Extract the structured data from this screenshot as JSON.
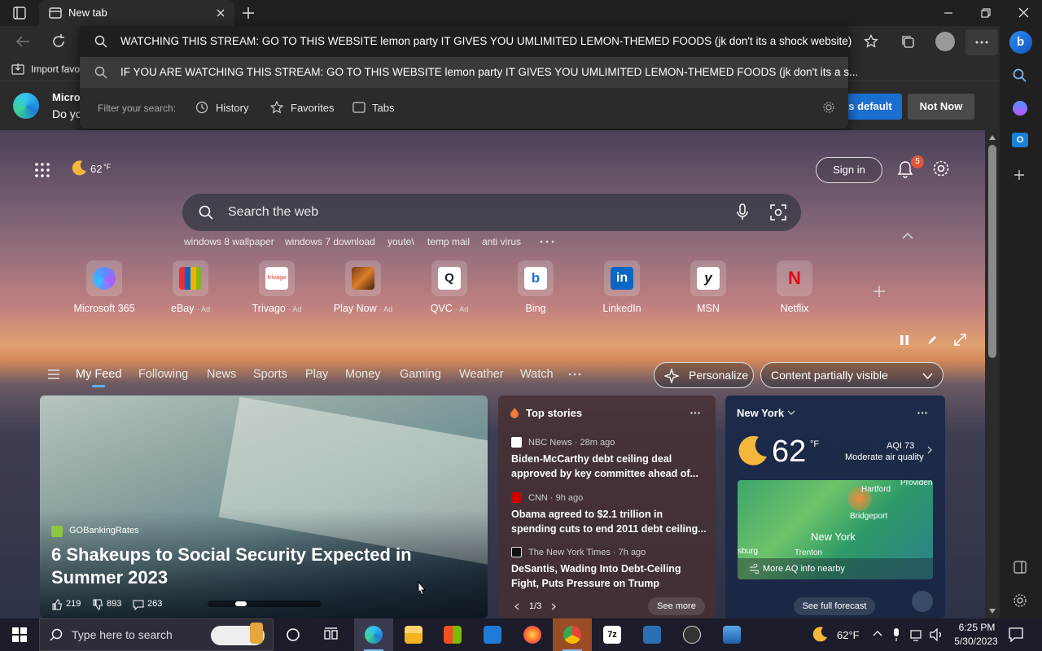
{
  "tab": {
    "title": "New tab"
  },
  "address": {
    "suggestion1": "WATCHING THIS STREAM: GO TO THIS WEBSITE lemon party IT GIVES YOU UMLIMITED LEMON-THEMED FOODS (jk don't its a shock website)",
    "suggestion2": "IF YOU ARE WATCHING THIS STREAM: GO TO THIS WEBSITE lemon party IT GIVES YOU UMLIMITED LEMON-THEMED FOODS (jk don't its a s...",
    "filter_label": "Filter your search:",
    "filters": [
      "History",
      "Favorites",
      "Tabs"
    ]
  },
  "favbar": {
    "import": "Import favo"
  },
  "infobar": {
    "title": "Micros",
    "text": "Do yo",
    "default_button": "s default",
    "notnow_button": "Not Now"
  },
  "page": {
    "weather_small": "62",
    "weather_unit": "°F",
    "signin": "Sign in",
    "notif_count": "5",
    "search_placeholder": "Search the web",
    "trending": [
      "windows 8 wallpaper",
      "windows 7 download",
      "youte\\",
      "temp mail",
      "anti virus"
    ],
    "tiles": [
      {
        "label": "Microsoft 365",
        "ad": ""
      },
      {
        "label": "eBay",
        "ad": "· Ad"
      },
      {
        "label": "Trivago",
        "ad": "· Ad"
      },
      {
        "label": "Play Now",
        "ad": "· Ad"
      },
      {
        "label": "QVC",
        "ad": "· Ad"
      },
      {
        "label": "Bing",
        "ad": ""
      },
      {
        "label": "LinkedIn",
        "ad": ""
      },
      {
        "label": "MSN",
        "ad": ""
      },
      {
        "label": "Netflix",
        "ad": ""
      }
    ],
    "feed_tabs": [
      "My Feed",
      "Following",
      "News",
      "Sports",
      "Play",
      "Money",
      "Gaming",
      "Weather",
      "Watch"
    ],
    "personalize": "Personalize",
    "content_visibility": "Content partially visible",
    "hero": {
      "source": "GOBankingRates",
      "headline": "6 Shakeups to Social Security Expected in Summer 2023",
      "likes": "219",
      "dislikes": "893",
      "comments": "263"
    },
    "top_stories": {
      "title": "Top stories",
      "items": [
        {
          "source": "NBC News · 28m ago",
          "headline": "Biden-McCarthy debt ceiling deal approved by key committee ahead of..."
        },
        {
          "source": "CNN · 9h ago",
          "headline": "Obama agreed to $2.1 trillion in spending cuts to end 2011 debt ceiling..."
        },
        {
          "source": "The New York Times · 7h ago",
          "headline": "DeSantis, Wading Into Debt-Ceiling Fight, Puts Pressure on Trump"
        }
      ],
      "pager": "1/3",
      "see_more": "See more"
    },
    "weather": {
      "location": "New York",
      "temp": "62",
      "unit": "°F",
      "aqi": "AQI 73",
      "aqi_text": "Moderate air quality",
      "map_labels": [
        "Hartford",
        "Providen",
        "Bridgeport",
        "New York",
        "sburg",
        "Trenton"
      ],
      "aq_link": "More AQ info nearby",
      "forecast": "See full forecast"
    }
  },
  "taskbar": {
    "search_placeholder": "Type here to search",
    "weather": "62°F",
    "time": "6:25 PM",
    "date": "5/30/2023"
  }
}
